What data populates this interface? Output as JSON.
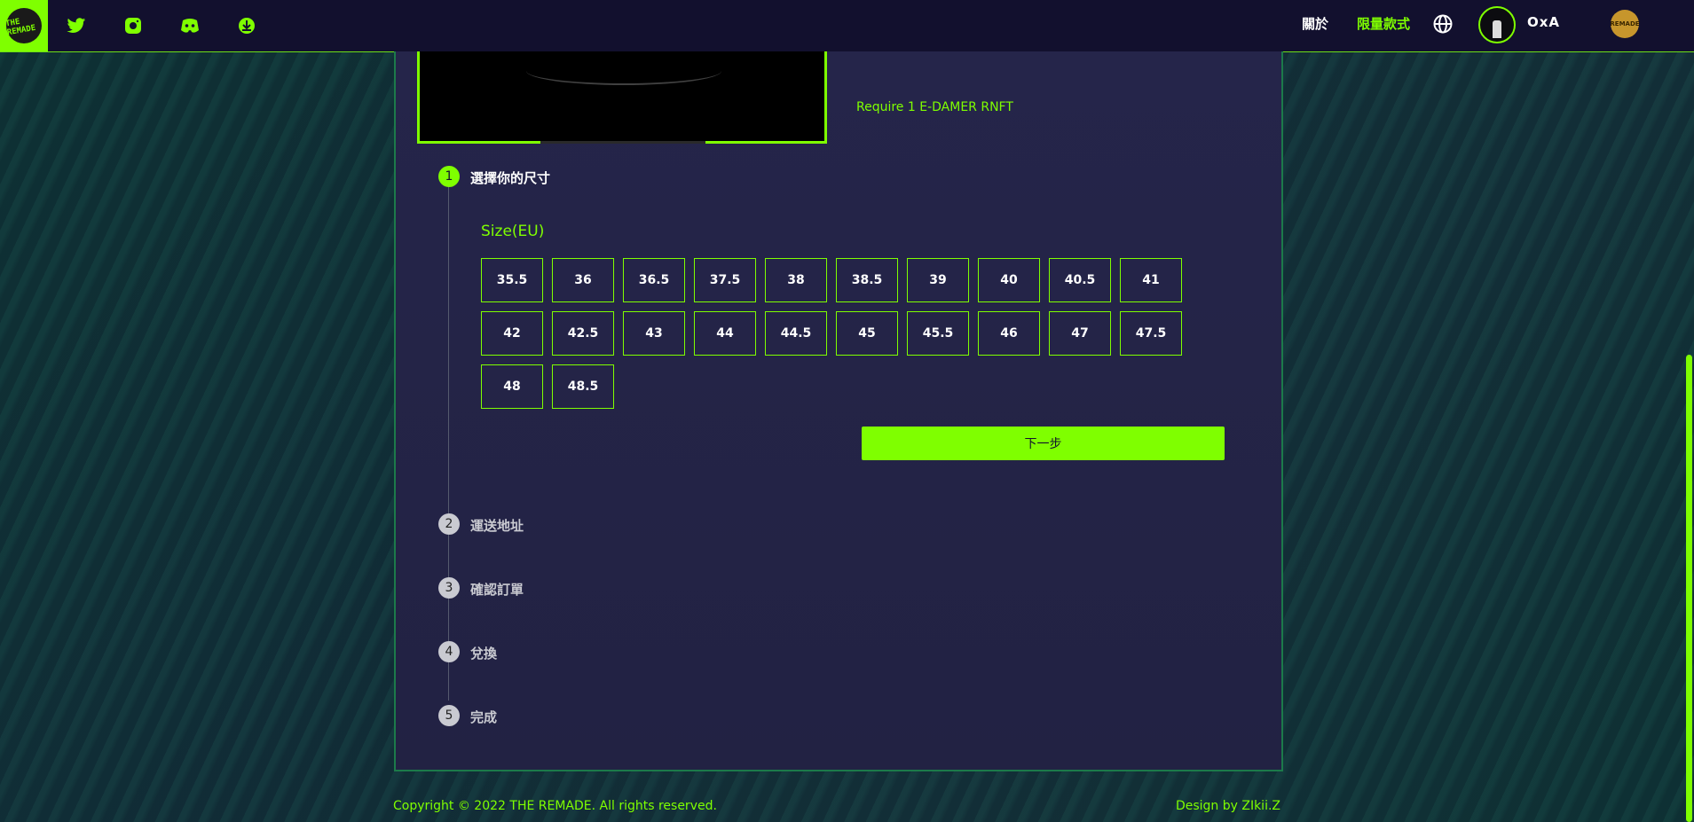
{
  "header": {
    "logo_text": "THE REMADE",
    "social": [
      {
        "name": "twitter-icon"
      },
      {
        "name": "instagram-icon"
      },
      {
        "name": "discord-icon"
      },
      {
        "name": "download-icon"
      }
    ],
    "nav_about": "關於",
    "nav_limited": "限量款式",
    "username": "OxA",
    "badge_text": "REMADE"
  },
  "product": {
    "require_text": "Require 1 E-DAMER RNFT"
  },
  "steps": [
    {
      "num": "1",
      "label": "選擇你的尺寸"
    },
    {
      "num": "2",
      "label": "運送地址"
    },
    {
      "num": "3",
      "label": "確認訂單"
    },
    {
      "num": "4",
      "label": "兌換"
    },
    {
      "num": "5",
      "label": "完成"
    }
  ],
  "size": {
    "label": "Size(EU)",
    "options": [
      "35.5",
      "36",
      "36.5",
      "37.5",
      "38",
      "38.5",
      "39",
      "40",
      "40.5",
      "41",
      "42",
      "42.5",
      "43",
      "44",
      "44.5",
      "45",
      "45.5",
      "46",
      "47",
      "47.5",
      "48",
      "48.5"
    ]
  },
  "next_button": "下一步",
  "footer": {
    "copyright": "Copyright © 2022 THE REMADE. All rights reserved.",
    "design": "Design by ZIkii.Z"
  },
  "colors": {
    "accent": "#7fff00",
    "topbar": "#12102e",
    "panel": "#25254a"
  }
}
